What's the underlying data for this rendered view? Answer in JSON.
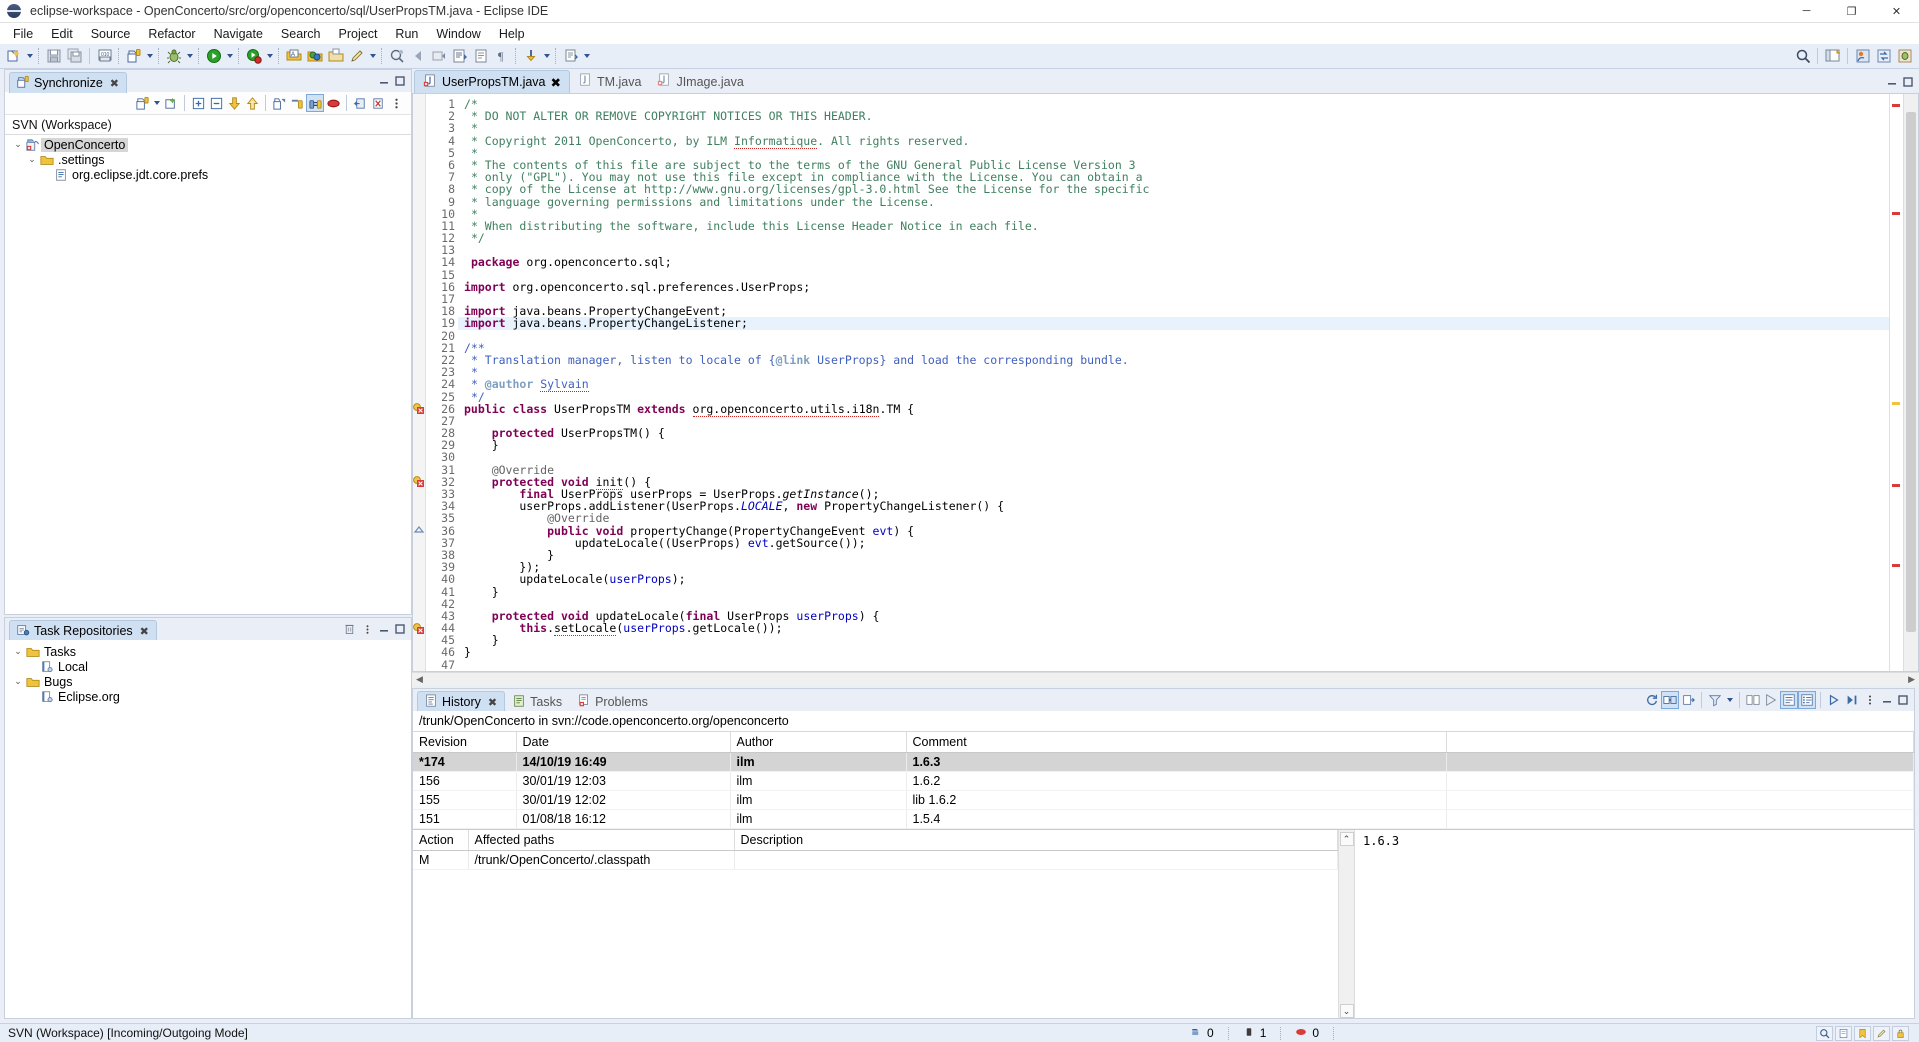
{
  "window": {
    "title": "eclipse-workspace - OpenConcerto/src/org/openconcerto/sql/UserPropsTM.java - Eclipse IDE",
    "minimize": "─",
    "maximize": "❐",
    "close": "✕"
  },
  "menubar": [
    "File",
    "Edit",
    "Source",
    "Refactor",
    "Navigate",
    "Search",
    "Project",
    "Run",
    "Window",
    "Help"
  ],
  "sync_view": {
    "tab_label": "Synchronize",
    "close_glyph": "✖",
    "scope_label": "SVN (Workspace)",
    "tree": [
      {
        "label": "OpenConcerto",
        "indent": 1,
        "twist": "⌄",
        "icon": "project-sync-icon",
        "selected": true
      },
      {
        "label": ".settings",
        "indent": 2,
        "twist": "⌄",
        "icon": "folder-icon",
        "selected": false
      },
      {
        "label": "org.eclipse.jdt.core.prefs",
        "indent": 3,
        "twist": "",
        "icon": "file-prefs-icon",
        "selected": false
      }
    ]
  },
  "tasks_view": {
    "tab_label": "Task Repositories",
    "close_glyph": "✖",
    "tree": [
      {
        "label": "Tasks",
        "indent": 1,
        "twist": "⌄",
        "icon": "folder-icon"
      },
      {
        "label": "Local",
        "indent": 2,
        "twist": "",
        "icon": "repository-icon"
      },
      {
        "label": "Bugs",
        "indent": 1,
        "twist": "⌄",
        "icon": "folder-icon"
      },
      {
        "label": "Eclipse.org",
        "indent": 2,
        "twist": "",
        "icon": "repository-icon"
      }
    ]
  },
  "editor": {
    "tabs": [
      {
        "label": "UserPropsTM.java",
        "active": true,
        "dirty": false,
        "icon": "java-error-file-icon",
        "close_glyph": "✖"
      },
      {
        "label": "TM.java",
        "active": false,
        "icon": "java-file-icon"
      },
      {
        "label": "JImage.java",
        "active": false,
        "icon": "java-error-file-icon"
      }
    ],
    "current_line": 19,
    "lines": [
      {
        "n": 1,
        "fold": "minus",
        "html": "<span class='cm'>/*</span>"
      },
      {
        "n": 2,
        "html": " <span class='cm'>* DO NOT ALTER OR REMOVE COPYRIGHT NOTICES OR THIS HEADER.</span>"
      },
      {
        "n": 3,
        "html": " <span class='cm'>*</span>"
      },
      {
        "n": 4,
        "html": " <span class='cm'>* Copyright 2011 OpenConcerto, by ILM <span class='sq'>Informatique</span>. All rights reserved.</span>"
      },
      {
        "n": 5,
        "html": " <span class='cm'>*</span>"
      },
      {
        "n": 6,
        "html": " <span class='cm'>* The contents of this file are subject to the terms of the GNU General Public License Version 3</span>"
      },
      {
        "n": 7,
        "html": " <span class='cm'>* only (\"GPL\"). You may not use this file except in compliance with the License. You can obtain a</span>"
      },
      {
        "n": 8,
        "html": " <span class='cm'>* copy of the License at http://www.gnu.org/licenses/gpl-3.0.html See the License for the specific</span>"
      },
      {
        "n": 9,
        "html": " <span class='cm'>* language governing permissions and limitations under the License.</span>"
      },
      {
        "n": 10,
        "html": " <span class='cm'>*</span>"
      },
      {
        "n": 11,
        "html": " <span class='cm'>* When distributing the software, include this License Header Notice in each file.</span>"
      },
      {
        "n": 12,
        "html": " <span class='cm'>*/</span>"
      },
      {
        "n": 13,
        "html": ""
      },
      {
        "n": 14,
        "html": " <span class='kw'>package</span> org.openconcerto.sql;"
      },
      {
        "n": 15,
        "html": ""
      },
      {
        "n": 16,
        "fold": "minus",
        "html": "<span class='kw'>import</span> org.openconcerto.sql.preferences.UserProps;"
      },
      {
        "n": 17,
        "html": ""
      },
      {
        "n": 18,
        "html": "<span class='kw'>import</span> java.beans.PropertyChangeEvent;"
      },
      {
        "n": 19,
        "html": "<span class='kw'>import</span> java.beans.PropertyChangeListener;",
        "highlight": true
      },
      {
        "n": 20,
        "html": ""
      },
      {
        "n": 21,
        "fold": "minus",
        "html": "<span class='jd'>/**</span>"
      },
      {
        "n": 22,
        "html": " <span class='jd'>* Translation manager, listen to locale of {<span class='jdt'>@link</span> UserProps} and load the corresponding bundle.</span>"
      },
      {
        "n": 23,
        "html": " <span class='jd'>*</span>"
      },
      {
        "n": 24,
        "html": " <span class='jd'>* <span class='jdt'>@author</span> <span class='sq'>Sylvain</span></span>"
      },
      {
        "n": 25,
        "html": " <span class='jd'>*/</span>"
      },
      {
        "n": 26,
        "marker": "error",
        "html": "<span class='kw'>public</span> <span class='kw'>class</span> UserPropsTM <span class='kw'>extends</span> <span class='sq'>org.openconcerto.utils.i18n</span>.TM {"
      },
      {
        "n": 27,
        "html": ""
      },
      {
        "n": 28,
        "fold": "minus",
        "html": "    <span class='kw'>protected</span> UserPropsTM() {"
      },
      {
        "n": 29,
        "html": "    }"
      },
      {
        "n": 30,
        "html": ""
      },
      {
        "n": 31,
        "fold": "minus",
        "html": "    <span class='ann'>@Override</span>"
      },
      {
        "n": 32,
        "marker": "error",
        "html": "    <span class='kw'>protected</span> <span class='kw'>void</span> <span class='sq'>init</span>() {"
      },
      {
        "n": 33,
        "html": "        <span class='kw'>final</span> UserProps userProps = UserProps.<span class='ital'>getInstance</span>();"
      },
      {
        "n": 34,
        "fold": "minus",
        "html": "        userProps.addListener(UserProps.<span class='fld ital'>LOCALE</span>, <span class='kw'>new</span> PropertyChangeListener() {"
      },
      {
        "n": 35,
        "fold": "minus",
        "html": "            <span class='ann'>@Override</span>"
      },
      {
        "n": 36,
        "marker": "override",
        "html": "            <span class='kw'>public</span> <span class='kw'>void</span> propertyChange(PropertyChangeEvent <span class='fld'>evt</span>) {"
      },
      {
        "n": 37,
        "html": "                updateLocale((UserProps) <span class='fld'>evt</span>.getSource());"
      },
      {
        "n": 38,
        "html": "            }"
      },
      {
        "n": 39,
        "html": "        });"
      },
      {
        "n": 40,
        "html": "        updateLocale(<span class='fld'>userProps</span>);"
      },
      {
        "n": 41,
        "html": "    }"
      },
      {
        "n": 42,
        "html": ""
      },
      {
        "n": 43,
        "fold": "minus",
        "html": "    <span class='kw'>protected</span> <span class='kw'>void</span> updateLocale(<span class='kw'>final</span> UserProps <span class='fld'>userProps</span>) {"
      },
      {
        "n": 44,
        "marker": "error",
        "html": "        <span class='kw'>this</span>.<span class='sq'>setLocale</span>(<span class='fld'>userProps</span>.getLocale());"
      },
      {
        "n": 45,
        "html": "    }"
      },
      {
        "n": 46,
        "html": "}"
      },
      {
        "n": 47,
        "html": ""
      }
    ]
  },
  "bottom_view": {
    "tabs": [
      {
        "label": "History",
        "active": true,
        "icon": "history-icon",
        "close_glyph": "✖"
      },
      {
        "label": "Tasks",
        "active": false,
        "icon": "tasks-icon"
      },
      {
        "label": "Problems",
        "active": false,
        "icon": "problems-icon"
      }
    ],
    "path": "/trunk/OpenConcerto in svn://code.openconcerto.org/openconcerto",
    "columns": [
      "Revision",
      "Date",
      "Author",
      "Comment"
    ],
    "rows": [
      {
        "revision": "*174",
        "date": "14/10/19 16:49",
        "author": "ilm",
        "comment": "1.6.3",
        "selected": true
      },
      {
        "revision": "156",
        "date": "30/01/19 12:03",
        "author": "ilm",
        "comment": "1.6.2",
        "selected": false
      },
      {
        "revision": "155",
        "date": "30/01/19 12:02",
        "author": "ilm",
        "comment": "lib 1.6.2",
        "selected": false
      },
      {
        "revision": "151",
        "date": "01/08/18 16:12",
        "author": "ilm",
        "comment": "1.5.4",
        "selected": false
      }
    ],
    "detail_columns": [
      "Action",
      "Affected paths",
      "Description"
    ],
    "detail_rows": [
      {
        "action": "M",
        "path": "/trunk/OpenConcerto/.classpath",
        "description": ""
      }
    ],
    "comment_text": "1.6.3",
    "scroll_up": "⌃",
    "scroll_down": "⌄"
  },
  "statusbar": {
    "text": "SVN (Workspace) [Incoming/Outgoing Mode]",
    "counts": [
      {
        "icon": "incoming-icon",
        "value": "0",
        "color": "#2a5fa8"
      },
      {
        "icon": "outgoing-icon",
        "value": "1",
        "color": "#3c3c3c"
      },
      {
        "icon": "conflict-icon",
        "value": "0",
        "color": "#cf2f2f"
      }
    ]
  },
  "colors": {
    "accent": "#cfe0f2",
    "toolbar_bg": "#e8eef8",
    "selection": "#d4d4d4",
    "current_line": "#e8f2fd",
    "keyword": "#7f0055",
    "comment": "#3f7f5f",
    "javadoc": "#3f5fbf",
    "string": "#2a00ff",
    "field": "#0000c0",
    "error": "#cf2020"
  }
}
